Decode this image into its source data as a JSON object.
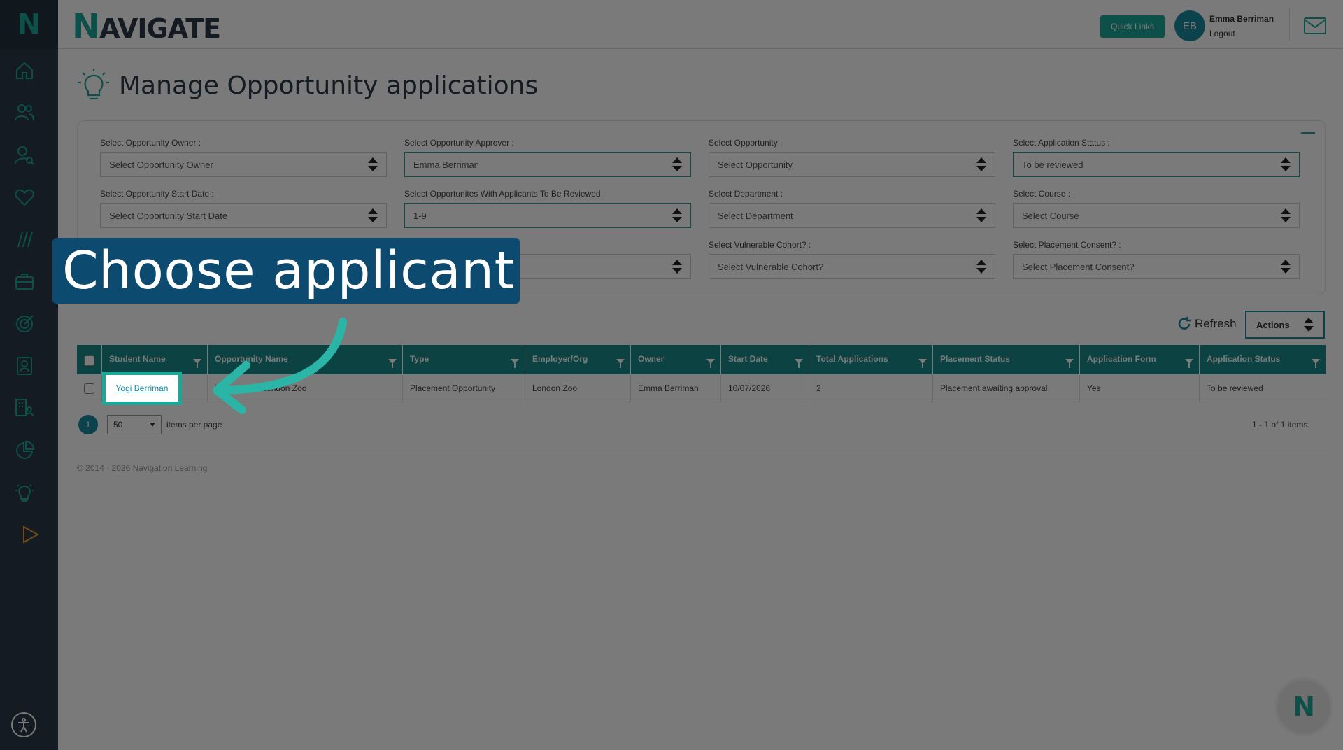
{
  "app": {
    "logo_letter": "N",
    "brand_first": "N",
    "brand_rest": "AVIGATE"
  },
  "header": {
    "quick_links": "Quick Links",
    "avatar_initials": "EB",
    "user_name": "Emma Berriman",
    "logout": "Logout"
  },
  "sidebar": {
    "icons": [
      "home-icon",
      "people-icon",
      "user-search-icon",
      "heart-icon",
      "slashes-icon",
      "briefcase-icon",
      "target-icon",
      "id-card-icon",
      "building-user-icon",
      "pie-chart-icon",
      "lightbulb-icon",
      "play-icon"
    ]
  },
  "page": {
    "title": "Manage Opportunity applications"
  },
  "filters": [
    {
      "label": "Select Opportunity Owner :",
      "value": "Select Opportunity Owner"
    },
    {
      "label": "Select Opportunity Approver :",
      "value": "Emma Berriman"
    },
    {
      "label": "Select Opportunity :",
      "value": "Select Opportunity"
    },
    {
      "label": "Select Application Status :",
      "value": "To be reviewed"
    },
    {
      "label": "Select Opportunity Start Date :",
      "value": "Select Opportunity Start Date"
    },
    {
      "label": "Select Opportunites With Applicants To Be Reviewed :",
      "value": "1-9"
    },
    {
      "label": "Select Department :",
      "value": "Select Department"
    },
    {
      "label": "Select Course :",
      "value": "Select Course"
    },
    {
      "label": "",
      "value": ""
    },
    {
      "label": "",
      "value": ""
    },
    {
      "label": "Select Vulnerable Cohort? :",
      "value": "Select Vulnerable Cohort?"
    },
    {
      "label": "Select Placement Consent? :",
      "value": "Select Placement Consent?"
    }
  ],
  "toolbar": {
    "refresh": "Refresh",
    "actions": "Actions"
  },
  "grid": {
    "columns": [
      "Student Name",
      "Opportunity Name",
      "Type",
      "Employer/Org",
      "Owner",
      "Start Date",
      "Total Applications",
      "Placement Status",
      "Application Form",
      "Application Status"
    ],
    "rows": [
      [
        "Yogi Berriman",
        "Placement - London Zoo",
        "Placement Opportunity",
        "London Zoo",
        "Emma Berriman",
        "10/07/2026",
        "2",
        "Placement awaiting approval",
        "Yes",
        "To be reviewed"
      ]
    ]
  },
  "pager": {
    "page": "1",
    "page_size": "50",
    "per_page_label": "items per page",
    "info": "1 - 1 of 1 items"
  },
  "footer": {
    "copyright": "© 2014 - 2026 Navigation Learning"
  },
  "tutorial": {
    "callout": "Choose applicant"
  },
  "colors": {
    "accent": "#1aa898",
    "sidebar": "#2b3a4a",
    "grid_header": "#1a8a8a",
    "callout": "#0d4a70"
  }
}
